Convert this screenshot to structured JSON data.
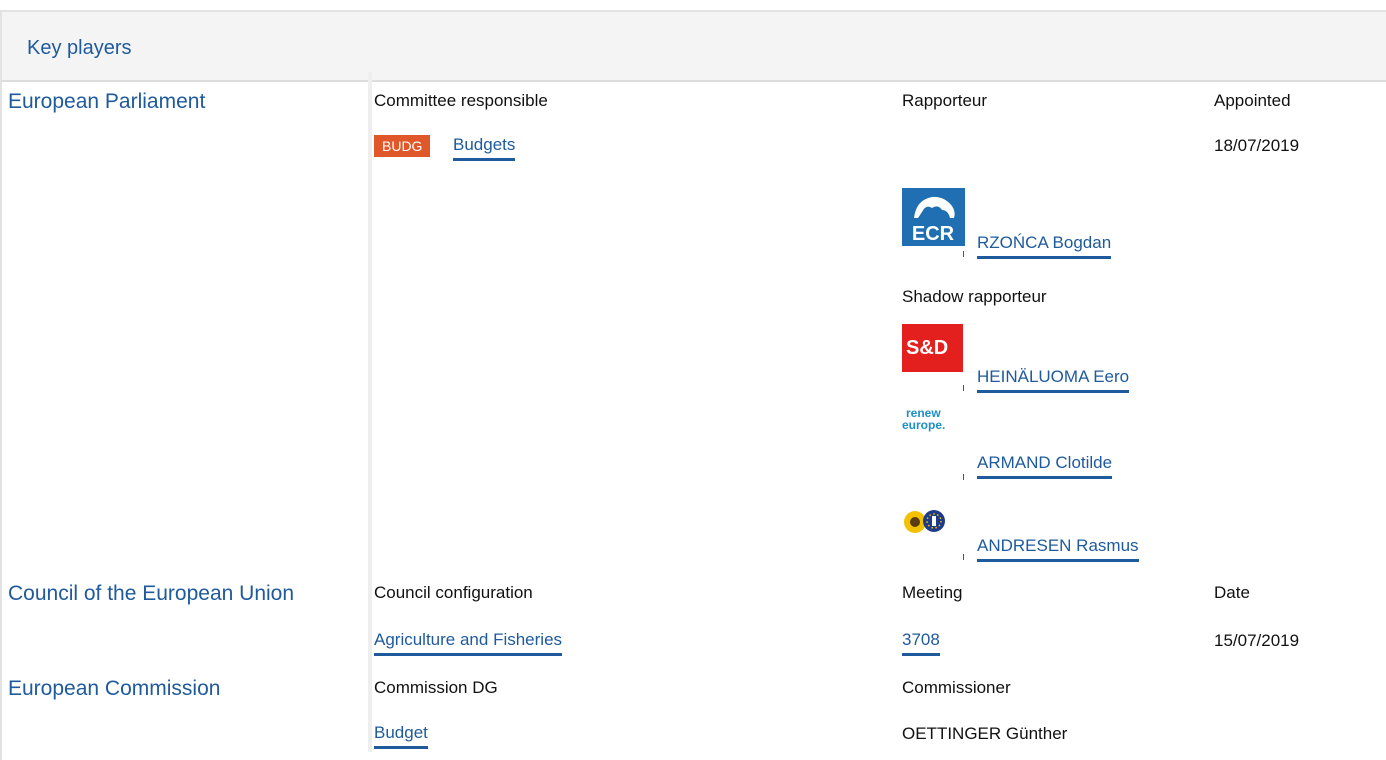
{
  "section_title": "Key players",
  "parliament": {
    "institution": "European Parliament",
    "committee_header": "Committee responsible",
    "rapporteur_header": "Rapporteur",
    "appointed_header": "Appointed",
    "committee_badge": "BUDG",
    "committee_name": "Budgets",
    "appointed_date": "18/07/2019",
    "rapporteur": {
      "group_logo": "ECR",
      "name": "RZOŃCA Bogdan"
    },
    "shadow_header": "Shadow rapporteur",
    "shadows": [
      {
        "group_logo": "S&D",
        "name": "HEINÄLUOMA Eero"
      },
      {
        "group_logo_line1": "renew",
        "group_logo_line2": "europe.",
        "name": "ARMAND Clotilde"
      },
      {
        "group_logo": "greens-efa-icon",
        "name": "ANDRESEN Rasmus"
      }
    ],
    "colors": {
      "ecr": "#1f6fb2",
      "sd": "#e4201f",
      "renew": "#1d8fc9",
      "badge": "#e0572a"
    }
  },
  "council": {
    "institution": "Council of the European Union",
    "config_header": "Council configuration",
    "meeting_header": "Meeting",
    "date_header": "Date",
    "configuration": "Agriculture and Fisheries",
    "meeting": "3708",
    "date": "15/07/2019"
  },
  "commission": {
    "institution": "European Commission",
    "dg_header": "Commission DG",
    "commissioner_header": "Commissioner",
    "dg": "Budget",
    "commissioner": "OETTINGER Günther"
  }
}
